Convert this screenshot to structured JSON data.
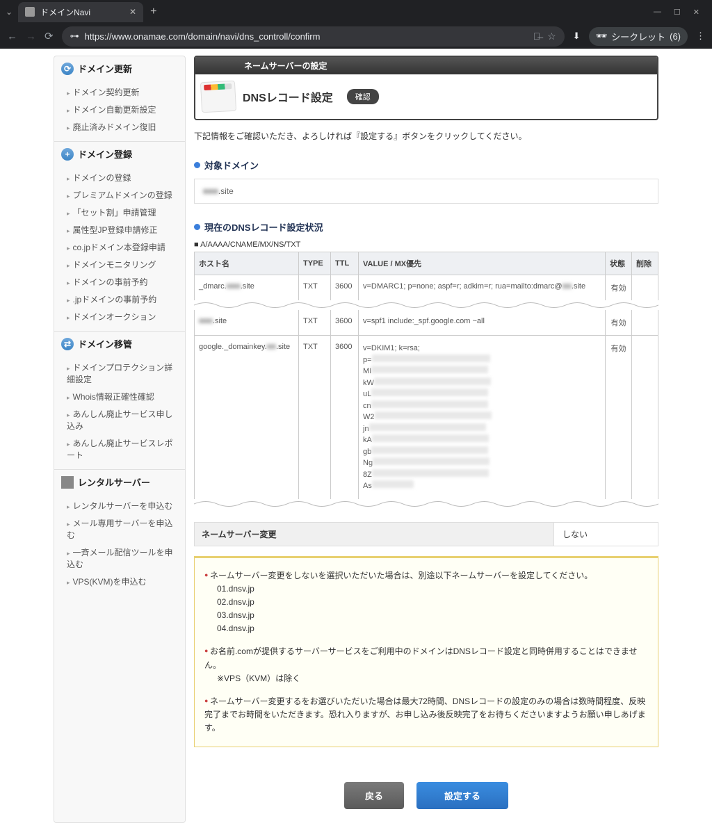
{
  "browser": {
    "tab_title": "ドメインNavi",
    "url": "https://www.onamae.com/domain/navi/dns_controll/confirm",
    "incognito": "シークレット",
    "incognito_count": "(6)"
  },
  "sidebar": {
    "sections": [
      {
        "title": "ドメイン更新",
        "icon": "refresh",
        "items": [
          "ドメイン契約更新",
          "ドメイン自動更新設定",
          "廃止済みドメイン復旧"
        ]
      },
      {
        "title": "ドメイン登録",
        "icon": "plus",
        "items": [
          "ドメインの登録",
          "プレミアムドメインの登録",
          "「セット割」申請管理",
          "属性型JP登録申請修正",
          "co.jpドメイン本登録申請",
          "ドメインモニタリング",
          "ドメインの事前予約",
          ".jpドメインの事前予約",
          "ドメインオークション"
        ]
      },
      {
        "title": "ドメイン移管",
        "icon": "transfer",
        "items": [
          "ドメインプロテクション詳細設定",
          "Whois情報正確性確認",
          "あんしん廃止サービス申し込み",
          "あんしん廃止サービスレポート"
        ]
      },
      {
        "title": "レンタルサーバー",
        "icon": "server",
        "items": [
          "レンタルサーバーを申込む",
          "メール専用サーバーを申込む",
          "一斉メール配信ツールを申込む",
          "VPS(KVM)を申込む"
        ]
      }
    ]
  },
  "header": {
    "breadcrumb": "ネームサーバーの設定",
    "title": "DNSレコード設定",
    "chip": "確認",
    "instruction": "下記情報をご確認いただき、よろしければ『設定する』ボタンをクリックしてください。"
  },
  "target_domain": {
    "label": "対象ドメイン",
    "value": "■■■.site"
  },
  "dns_status": {
    "label": "現在のDNSレコード設定状況",
    "sub": "A/AAAA/CNAME/MX/NS/TXT",
    "headers": {
      "host": "ホスト名",
      "type": "TYPE",
      "ttl": "TTL",
      "value": "VALUE / MX優先",
      "status": "状態",
      "delete": "削除"
    },
    "rows": [
      {
        "host": "_dmarc.■■■.site",
        "type": "TXT",
        "ttl": "3600",
        "value": "v=DMARC1; p=none; aspf=r; adkim=r; rua=mailto:dmarc@■■■.site",
        "status": "有効"
      },
      {
        "host": "■■■.site",
        "type": "TXT",
        "ttl": "3600",
        "value": "v=spf1 include:_spf.google.com ~all",
        "status": "有効"
      },
      {
        "host": "google._domainkey.■■■.site",
        "type": "TXT",
        "ttl": "3600",
        "value": "v=DKIM1; k=rsa;\np=████████████████████████\nMI████████████████████████\nkW████████████████████████\nuL████████████████████████\ncn████████████████████████\nW2████████████████████████\njn████████████████████████\nkA████████████████████████\ngb████████████████████████\nNg████████████████████████\n8Z████████████████████████\nAs████████",
        "status": "有効"
      }
    ]
  },
  "ns": {
    "label": "ネームサーバー変更",
    "value": "しない"
  },
  "notices": {
    "n1": "ネームサーバー変更をしないを選択いただいた場合は、別途以下ネームサーバーを設定してください。",
    "servers": [
      "01.dnsv.jp",
      "02.dnsv.jp",
      "03.dnsv.jp",
      "04.dnsv.jp"
    ],
    "n2": "お名前.comが提供するサーバーサービスをご利用中のドメインはDNSレコード設定と同時併用することはできません。",
    "n2b": "※VPS（KVM）は除く",
    "n3": "ネームサーバー変更するをお選びいただいた場合は最大72時間、DNSレコードの設定のみの場合は数時間程度、反映完了までお時間をいただきます。恐れ入りますが、お申し込み後反映完了をお待ちくださいますようお願い申しあげます。"
  },
  "buttons": {
    "back": "戻る",
    "submit": "設定する"
  }
}
